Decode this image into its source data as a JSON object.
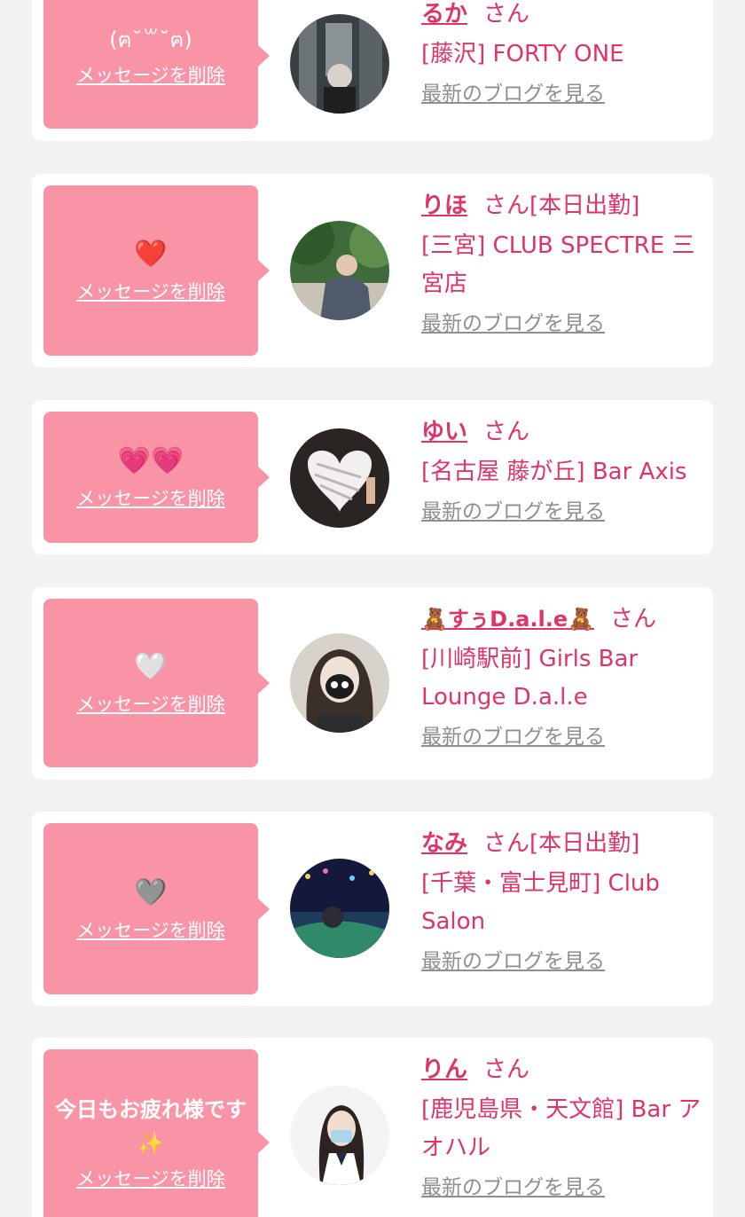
{
  "delete_label": "メッセージを削除",
  "blog_label": "最新のブログを見る",
  "san_label": "さん",
  "colors": {
    "accent": "#e0336a",
    "bubble": "#f994a7",
    "background": "#f2f2f2"
  },
  "cards": [
    {
      "message": "(ฅ˘꒳˘ฅ)",
      "name": "るか",
      "status": "",
      "shop": "[藤沢] FORTY ONE"
    },
    {
      "message": "❤️",
      "name": "りほ",
      "status": "[本日出勤]",
      "shop": "[三宮] CLUB SPECTRE 三宮店"
    },
    {
      "message": "💗💗",
      "name": "ゆい",
      "status": "",
      "shop": "[名古屋 藤が丘] Bar Axis"
    },
    {
      "message": "🤍",
      "name": "🧸すぅD.a.l.e🧸",
      "status": "",
      "shop": "[川崎駅前] Girls Bar Lounge D.a.l.e"
    },
    {
      "message": "🩶",
      "name": "なみ",
      "status": "[本日出勤]",
      "shop": "[千葉・富士見町] Club Salon"
    },
    {
      "message": "今日もお疲れ様です✨",
      "name": "りん",
      "status": "",
      "shop": "[鹿児島県・天文館] Bar アオハル"
    }
  ]
}
